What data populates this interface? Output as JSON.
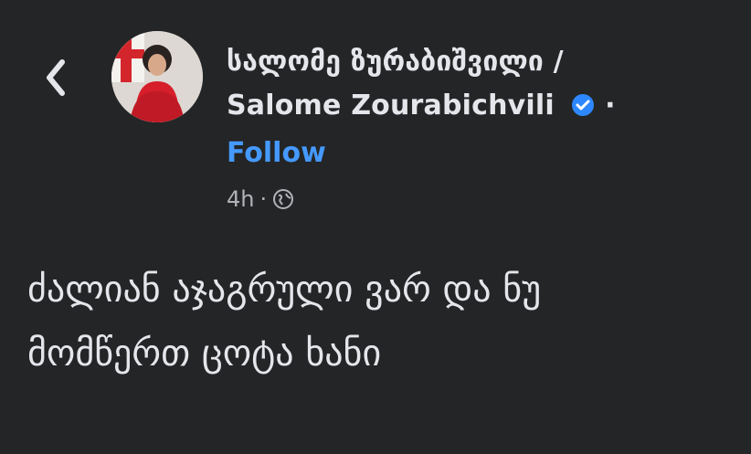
{
  "colors": {
    "background": "#242526",
    "text": "#e4e6eb",
    "follow": "#4599ff",
    "meta": "#b0b3b8",
    "verified": "#2d88ff"
  },
  "header": {
    "back_icon": "chevron-left-icon",
    "author": {
      "name_georgian": "სალომე ზურაბიშვილი /",
      "name_latin": "Salome Zourabichvili",
      "separator": "·",
      "verified_icon": "verified-badge-icon"
    },
    "follow_label": "Follow",
    "meta": {
      "time": "4h",
      "separator": "·",
      "privacy_icon": "globe-icon"
    }
  },
  "post": {
    "lines": [
      "ძალიან აჯაგრული ვარ და ნუ",
      "მომწერთ ცოტა ხანი"
    ]
  }
}
